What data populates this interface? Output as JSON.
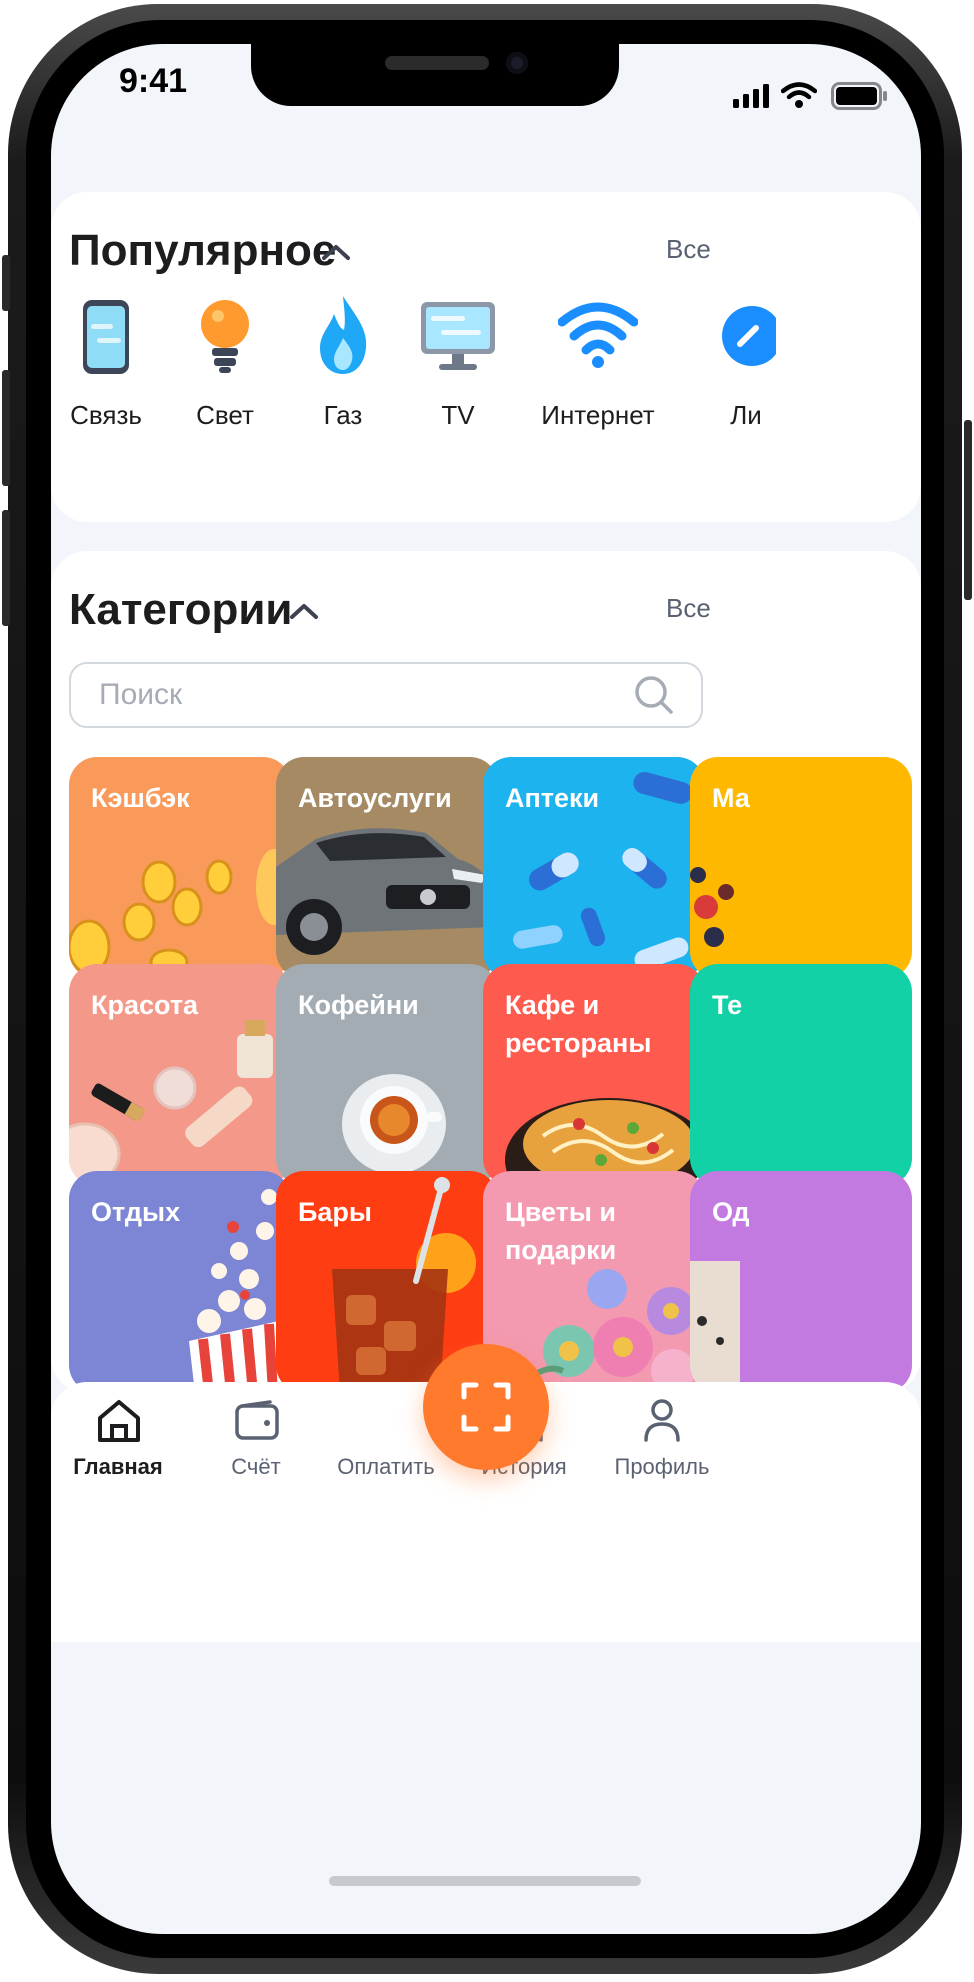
{
  "status_bar": {
    "time": "9:41"
  },
  "popular": {
    "title": "Популярное",
    "all_label": "Все",
    "items": [
      {
        "label": "Связь",
        "icon": "phone-icon"
      },
      {
        "label": "Свет",
        "icon": "lightbulb-icon"
      },
      {
        "label": "Газ",
        "icon": "flame-icon"
      },
      {
        "label": "TV",
        "icon": "tv-icon"
      },
      {
        "label": "Интернет",
        "icon": "wifi-icon"
      },
      {
        "label": "Ли",
        "icon": "partial-icon"
      }
    ]
  },
  "categories": {
    "title": "Категории",
    "all_label": "Все",
    "search_placeholder": "Поиск",
    "tiles": [
      {
        "label": "Кэшбэк",
        "color": "#f99a5b"
      },
      {
        "label": "Автоуслуги",
        "color": "#a68a63"
      },
      {
        "label": "Аптеки",
        "color": "#1cb3ee"
      },
      {
        "label": "Ма",
        "color": "#ffb800"
      },
      {
        "label": "Красота",
        "color": "#f4998a"
      },
      {
        "label": "Кофейни",
        "color": "#a3acb2"
      },
      {
        "label": "Кафе и рестораны",
        "color": "#ff5a4e"
      },
      {
        "label": "Те",
        "color": "#12d1a6"
      },
      {
        "label": "Отдых",
        "color": "#7d86d4"
      },
      {
        "label": "Бары",
        "color": "#ff3d13"
      },
      {
        "label": "Цветы и подарки",
        "color": "#f39ab0"
      },
      {
        "label": "Од",
        "color": "#c27ae0"
      }
    ]
  },
  "tabbar": {
    "home": "Главная",
    "account": "Счёт",
    "pay": "Оплатить",
    "history": "История",
    "profile": "Профиль"
  },
  "colors": {
    "accent": "#ff7a2d",
    "screen_bg": "#f2f5fa"
  }
}
